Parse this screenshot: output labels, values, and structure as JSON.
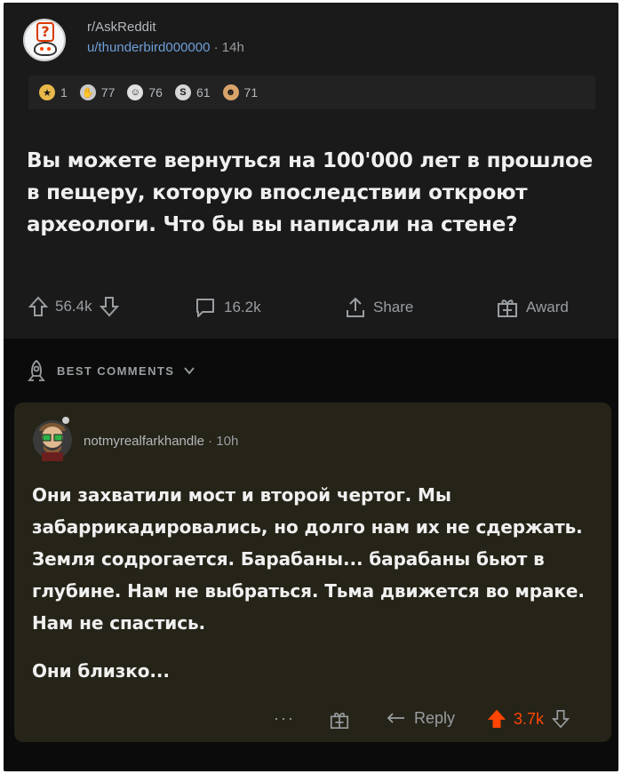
{
  "post": {
    "subreddit": "r/AskReddit",
    "author": "u/thunderbird000000",
    "separator": "·",
    "age": "14h",
    "awards": [
      {
        "icon": "gold-award-icon",
        "color": "#e8b84a",
        "count": "1"
      },
      {
        "icon": "hands-award-icon",
        "color": "#c9c9c9",
        "count": "77"
      },
      {
        "icon": "face-award-icon",
        "color": "#e0e0e0",
        "count": "76"
      },
      {
        "icon": "s-award-icon",
        "color": "#d6d6d6",
        "count": "61"
      },
      {
        "icon": "laugh-award-icon",
        "color": "#d8a36a",
        "count": "71"
      }
    ],
    "title": "Вы можете вернуться на 100'000 лет в прошлое в пещеру, которую впоследствии откроют археологи. Что бы вы написали на стене?",
    "upvotes": "56.4k",
    "comments": "16.2k",
    "share_label": "Share",
    "award_label": "Award"
  },
  "best_comments_label": "BEST COMMENTS",
  "comment": {
    "username": "notmyrealfarkhandle",
    "separator": "·",
    "age": "10h",
    "paragraph1": "Они захватили мост и второй чертог. Мы забаррикадировались, но долго нам их не сдержать. Земля содрогается. Барабаны... барабаны бьют в глубине. Нам не выбраться. Тьма движется во мраке. Нам не спастись.",
    "paragraph2": "Они близко...",
    "more": "···",
    "reply_label": "Reply",
    "score": "3.7k"
  },
  "colors": {
    "background": "#1a1a1b",
    "comment_background": "#262418",
    "upvote_active": "#ff4500",
    "link": "#6e9fd6"
  }
}
